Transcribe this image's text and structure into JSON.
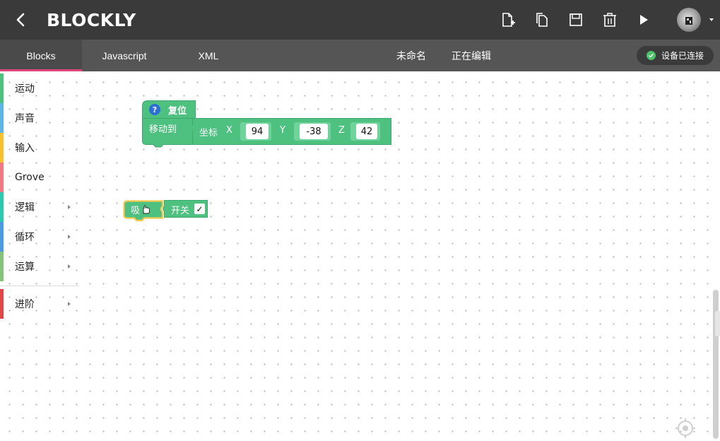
{
  "header": {
    "title": "BLOCKLY",
    "back_icon": "chevron-left-icon",
    "tools": [
      "new-file-icon",
      "copy-icon",
      "save-icon",
      "delete-icon",
      "run-icon"
    ]
  },
  "tabs": [
    {
      "label": "Blocks",
      "active": true
    },
    {
      "label": "Javascript",
      "active": false
    },
    {
      "label": "XML",
      "active": false
    }
  ],
  "file": {
    "name": "未命名",
    "status": "正在编辑"
  },
  "connection": {
    "label": "设备已连接",
    "color": "#4cc36b"
  },
  "toolbox": [
    {
      "label": "运动",
      "color": "#4ec07f",
      "has_arrow": false
    },
    {
      "label": "声音",
      "color": "#5fb4e6",
      "has_arrow": false
    },
    {
      "label": "输入",
      "color": "#f6c12f",
      "has_arrow": false
    },
    {
      "label": "Grove",
      "color": "#f07a84",
      "has_arrow": false
    },
    {
      "label": "逻辑",
      "color": "#2fc9b1",
      "has_arrow": true
    },
    {
      "label": "循环",
      "color": "#4c9be0",
      "has_arrow": true
    },
    {
      "label": "运算",
      "color": "#86c37a",
      "has_arrow": true
    },
    {
      "label": "进阶",
      "color": "#e04848",
      "has_arrow": true
    }
  ],
  "blocks": {
    "reset": {
      "label": "复位",
      "help": "?"
    },
    "move": {
      "label": "移动到",
      "coord_label": "坐标",
      "x_label": "X",
      "x_value": "94",
      "y_label": "Y",
      "y_value": "-38",
      "z_label": "Z",
      "z_value": "42"
    },
    "suction": {
      "label": "吸",
      "switch_label": "开关",
      "checked": "✓"
    }
  },
  "colors": {
    "topbar": "#3a3a3a",
    "tabbar": "#555555",
    "active_underline": "#e0457b",
    "block_green": "#4ec07f",
    "selected_outline": "#f2c94c"
  }
}
